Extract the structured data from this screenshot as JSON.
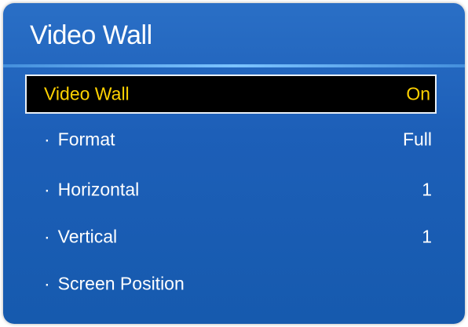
{
  "window": {
    "title": "Video Wall"
  },
  "menu": {
    "items": [
      {
        "label": "Video Wall",
        "value": "On",
        "prefix": ""
      },
      {
        "label": "Format",
        "value": "Full",
        "prefix": "·"
      },
      {
        "label": "Horizontal",
        "value": "1",
        "prefix": "·"
      },
      {
        "label": "Vertical",
        "value": "1",
        "prefix": "·"
      },
      {
        "label": "Screen Position",
        "value": "",
        "prefix": "·"
      }
    ]
  },
  "colors": {
    "panel_blue": "#1d5fb8",
    "highlight_text": "#ffd200",
    "selected_bg": "#000000"
  }
}
